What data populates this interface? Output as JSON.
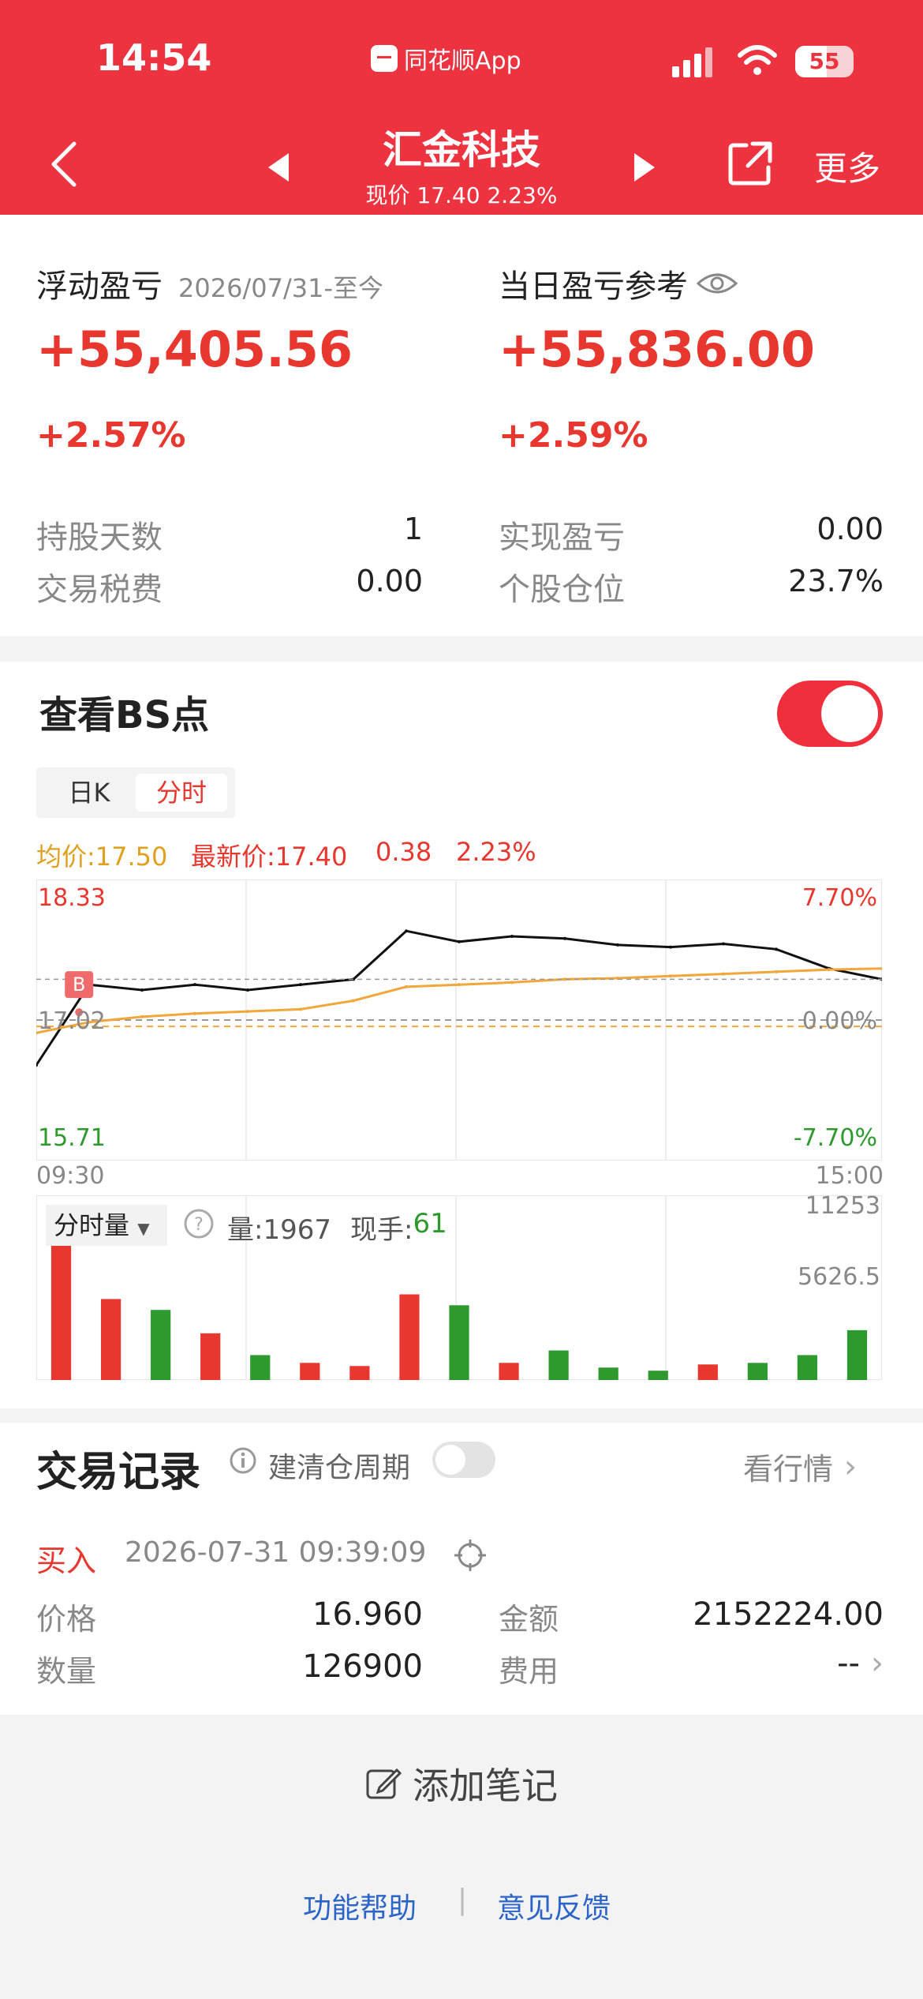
{
  "status": {
    "time": "14:54",
    "app_name": "同花顺App",
    "battery": "55"
  },
  "nav": {
    "title": "汇金科技",
    "subtitle": "现价 17.40 2.23%",
    "more": "更多"
  },
  "profit": {
    "floating_label": "浮动盈亏",
    "floating_date": "2026/07/31-至今",
    "floating_value": "+55,405.56",
    "floating_pct": "+2.57%",
    "daily_label": "当日盈亏参考",
    "daily_value": "+55,836.00",
    "daily_pct": "+2.59%",
    "rows": [
      {
        "label": "持股天数",
        "value": "1"
      },
      {
        "label": "实现盈亏",
        "value": "0.00"
      },
      {
        "label": "交易税费",
        "value": "0.00"
      },
      {
        "label": "个股仓位",
        "value": "23.7%"
      }
    ]
  },
  "bs": {
    "title": "查看BS点",
    "tab_day": "日K",
    "tab_intraday": "分时",
    "legend_avg": "均价:17.50",
    "legend_last": "最新价:17.40",
    "legend_change": "0.38",
    "legend_pct": "2.23%",
    "y_high": "18.33",
    "y_mid": "17.02",
    "y_low": "15.71",
    "pct_high": "7.70%",
    "pct_mid": "0.00%",
    "pct_low": "-7.70%",
    "t_start": "09:30",
    "t_end": "15:00",
    "buy_marker": "B",
    "vol_selector": "分时量",
    "vol_label": "量:1967",
    "hand_label": "现手:",
    "hand_value": "61",
    "vol_max": "11253",
    "vol_mid": "5626.5"
  },
  "chart_data": {
    "type": "line",
    "xlabel": "",
    "ylabel": "",
    "ylim": [
      15.71,
      18.33
    ],
    "x": [
      "09:30",
      "09:45",
      "10:00",
      "10:15",
      "10:30",
      "10:45",
      "11:00",
      "11:15",
      "11:30",
      "13:15",
      "13:30",
      "13:45",
      "14:00",
      "14:15",
      "14:30",
      "14:45",
      "15:00"
    ],
    "series": [
      {
        "values": [
          16.6,
          17.35,
          17.3,
          17.35,
          17.3,
          17.35,
          17.4,
          17.85,
          17.75,
          17.8,
          17.78,
          17.72,
          17.7,
          17.73,
          17.68,
          17.5,
          17.4
        ]
      },
      {
        "values": [
          16.9,
          17.0,
          17.05,
          17.08,
          17.1,
          17.12,
          17.2,
          17.33,
          17.35,
          17.37,
          17.4,
          17.41,
          17.43,
          17.45,
          17.47,
          17.49,
          17.5
        ]
      }
    ],
    "volume": [
      11253,
      5200,
      4500,
      3000,
      1600,
      1100,
      900,
      5500,
      4800,
      1100,
      1900,
      800,
      600,
      1000,
      1100,
      1600,
      3200
    ],
    "buy_price": 16.96,
    "buy_time": "09:39"
  },
  "trades": {
    "title": "交易记录",
    "info_icon": "info-icon",
    "cycle_label": "建清仓周期",
    "market_link": "看行情",
    "type": "买入",
    "datetime": "2026-07-31 09:39:09",
    "price_label": "价格",
    "price_value": "16.960",
    "amount_label": "金额",
    "amount_value": "2152224.00",
    "qty_label": "数量",
    "qty_value": "126900",
    "fee_label": "费用",
    "fee_value": "--"
  },
  "footer": {
    "add_note": "添加笔记",
    "help": "功能帮助",
    "divider": "|",
    "feedback": "意见反馈"
  },
  "colors": {
    "brand_red": "#ee3340",
    "up": "#e8372f",
    "down": "#2e9a2e",
    "avg_line": "#f2a73b",
    "link": "#2c64c8"
  }
}
